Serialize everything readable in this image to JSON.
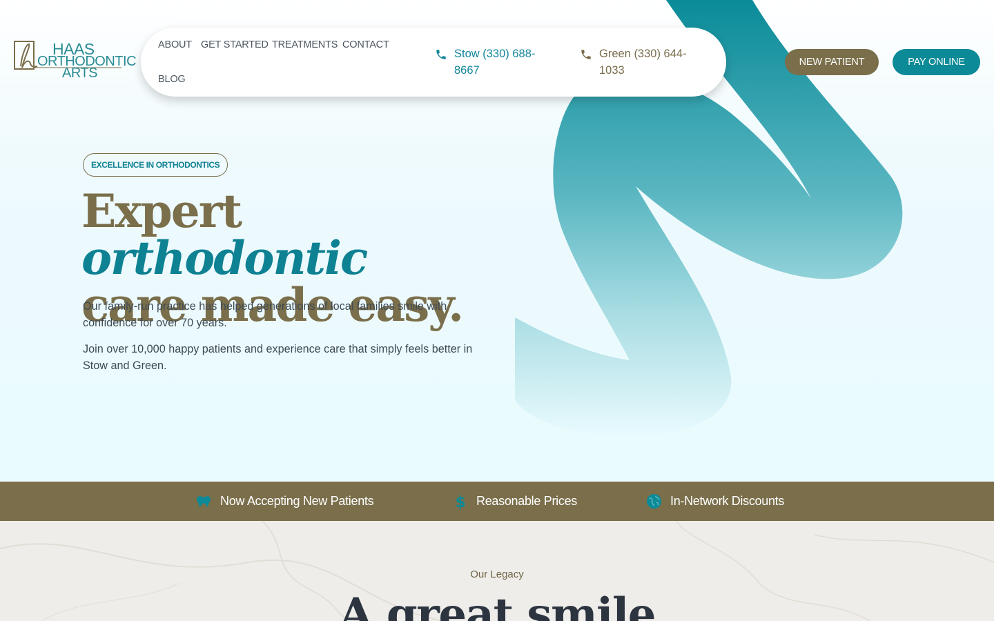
{
  "brand": {
    "logo_lines": [
      "HAAS",
      "ORTHODONTIC",
      "ARTS"
    ],
    "colors": {
      "teal": "#0c8a97",
      "olive": "#7a6e4b",
      "hero_bg": "#e9fbfe"
    }
  },
  "nav": {
    "items": [
      "ABOUT",
      "GET STARTED",
      "TREATMENTS",
      "CONTACT",
      "BLOG"
    ]
  },
  "phones": {
    "stow": {
      "label": "Stow (330) 688-8667",
      "icon": "phone-icon"
    },
    "green": {
      "label": "Green (330) 644-1033",
      "icon": "phone-icon"
    }
  },
  "header_buttons": {
    "new_patient": "NEW PATIENT",
    "pay_online": "PAY ONLINE"
  },
  "hero": {
    "badge": "EXCELLENCE IN ORTHODONTICS",
    "headline_part1": "Expert ",
    "headline_accent": "orthodontic",
    "headline_part2": "care made easy.",
    "paragraph1": "Our family-run practice has helped generations of local families smile with confidence for over 70 years.",
    "paragraph2": "Join over 10,000 happy patients and experience care that simply feels better in Stow and Green."
  },
  "features": [
    {
      "label": "Now Accepting New Patients",
      "icon": "tooth-icon"
    },
    {
      "label": "Reasonable Prices",
      "icon": "dollar-icon"
    },
    {
      "label": "In-Network Discounts",
      "icon": "globe-icon"
    }
  ],
  "legacy": {
    "eyebrow": "Our Legacy",
    "title": "A great smile"
  }
}
